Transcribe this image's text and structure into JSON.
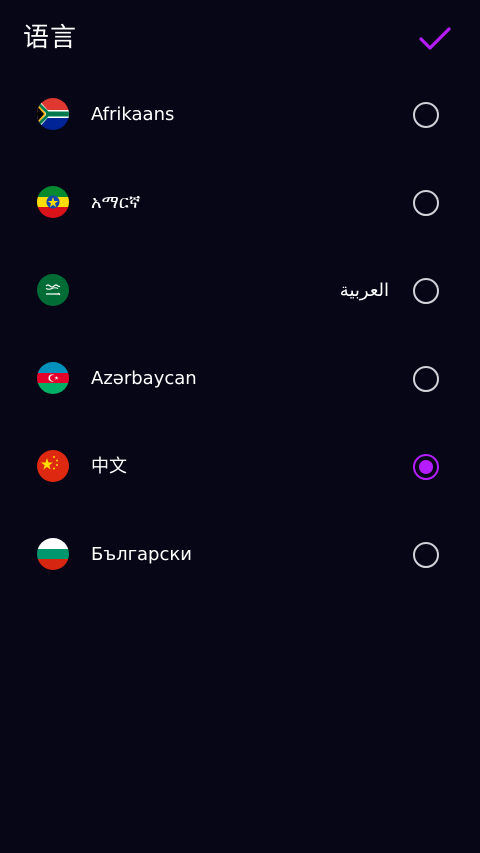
{
  "header": {
    "title": "语言",
    "confirm_icon": "check-icon"
  },
  "colors": {
    "background": "#070617",
    "accent": "#b51cff",
    "radio_border": "#d2d2d8",
    "text": "#ffffff"
  },
  "languages": [
    {
      "label": "Afrikaans",
      "flag_icon": "south-africa-flag-icon",
      "selected": false
    },
    {
      "label": "አማርኛ",
      "flag_icon": "ethiopia-flag-icon",
      "selected": false
    },
    {
      "label": "العربية",
      "flag_icon": "saudi-arabia-flag-icon",
      "selected": false
    },
    {
      "label": "Azərbaycan",
      "flag_icon": "azerbaijan-flag-icon",
      "selected": false
    },
    {
      "label": "中文",
      "flag_icon": "china-flag-icon",
      "selected": true
    },
    {
      "label": "Български",
      "flag_icon": "bulgaria-flag-icon",
      "selected": false
    }
  ]
}
